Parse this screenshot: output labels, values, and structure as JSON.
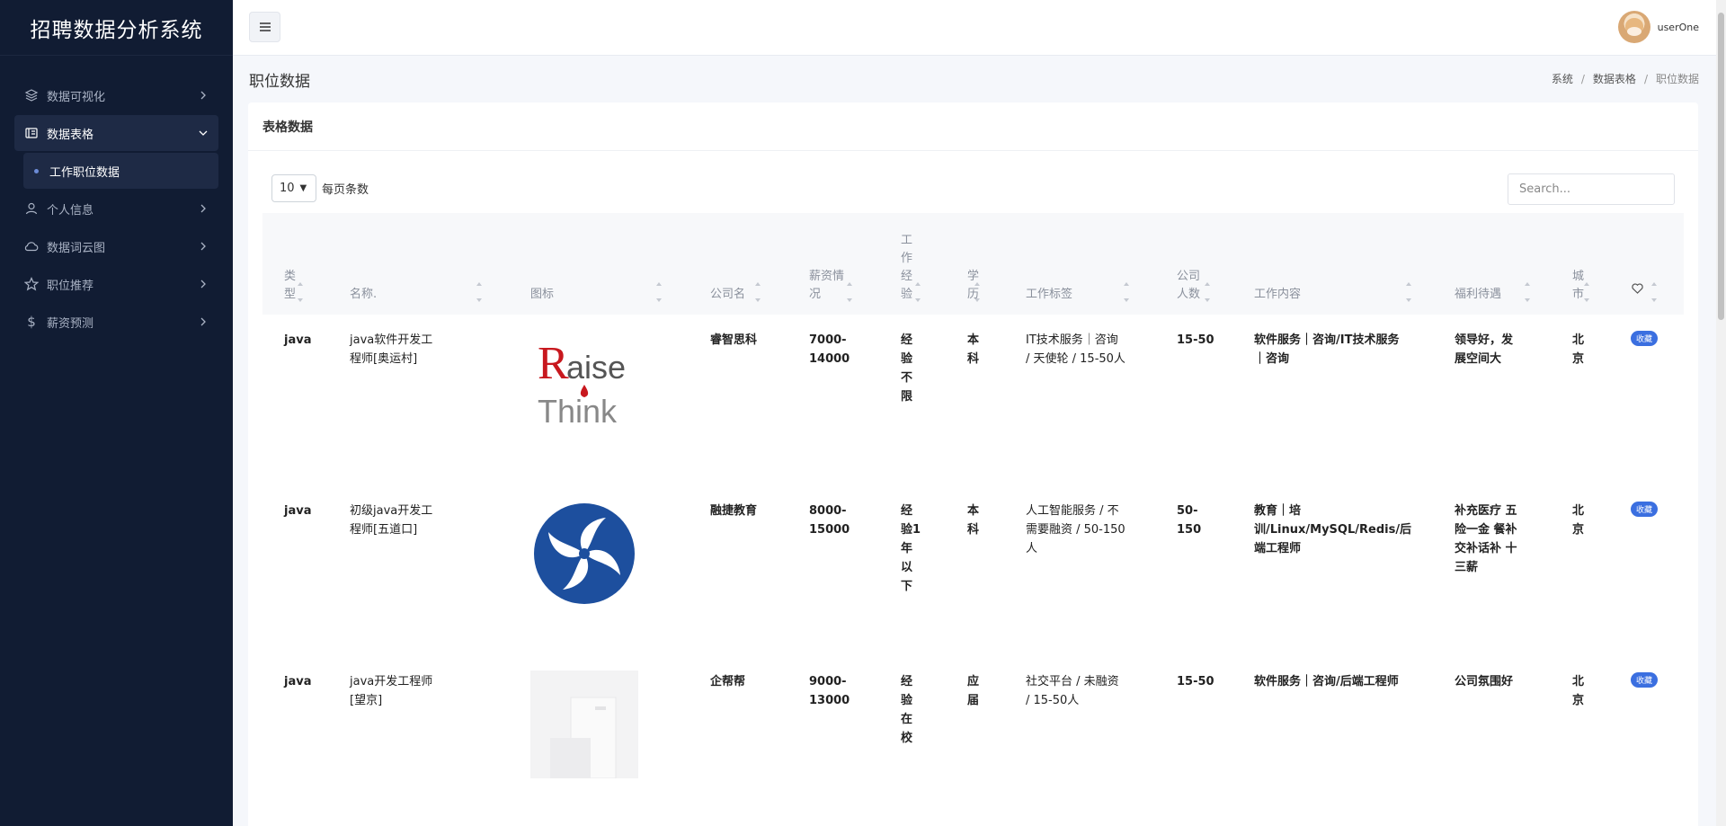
{
  "app": {
    "title": "招聘数据分析系统"
  },
  "sidebar": {
    "items": [
      {
        "label": "数据可视化",
        "icon": "layers-icon"
      },
      {
        "label": "数据表格",
        "icon": "table-icon",
        "expanded": true
      },
      {
        "label": "个人信息",
        "icon": "user-icon"
      },
      {
        "label": "数据词云图",
        "icon": "cloud-icon"
      },
      {
        "label": "职位推荐",
        "icon": "star-icon"
      },
      {
        "label": "薪资预测",
        "icon": "dollar-icon"
      }
    ],
    "subitems": [
      {
        "label": "工作职位数据"
      }
    ]
  },
  "header": {
    "username": "userOne"
  },
  "page": {
    "title": "职位数据",
    "breadcrumb": [
      "系统",
      "数据表格",
      "职位数据"
    ]
  },
  "card": {
    "title": "表格数据",
    "per_page_value": "10",
    "per_page_label": "每页条数",
    "search_placeholder": "Search..."
  },
  "table": {
    "headers": {
      "type": "类\n型",
      "name": "名称.",
      "logo": "图标",
      "company": "公司名",
      "salary": "薪资情\n况",
      "experience": "工\n作\n经\n验",
      "education": "学\n历",
      "tags": "工作标签",
      "size": "公司\n人数",
      "content": "工作内容",
      "benefits": "福利待遇",
      "city": "城\n市"
    },
    "rows": [
      {
        "type": "java",
        "name": "java软件开发工\n程师[奥运村]",
        "logo": "raise-think-logo",
        "company": "睿智思科",
        "salary": "7000-\n14000",
        "experience": "经\n验\n不\n限",
        "education": "本\n科",
        "tags": "IT技术服务｜咨询\n/ 天使轮 / 15-50人",
        "size": "15-50",
        "content": "软件服务｜咨询/IT技术服务\n｜咨询",
        "benefits": "领导好，发\n展空间大",
        "city": "北\n京",
        "fav": "收藏"
      },
      {
        "type": "java",
        "name": "初级java开发工\n程师[五道口]",
        "logo": "blue-circle-logo",
        "company": "融捷教育",
        "salary": "8000-\n15000",
        "experience": "经\n验1\n年\n以\n下",
        "education": "本\n科",
        "tags": "人工智能服务 / 不\n需要融资 / 50-150\n人",
        "size": "50-\n150",
        "content": "教育｜培\n训/Linux/MySQL/Redis/后\n端工程师",
        "benefits": "补充医疗 五\n险一金 餐补\n交补话补 十\n三薪",
        "city": "北\n京",
        "fav": "收藏"
      },
      {
        "type": "java",
        "name": "java开发工程师\n[望京]",
        "logo": "building-placeholder-logo",
        "company": "企帮帮",
        "salary": "9000-\n13000",
        "experience": "经\n验\n在\n校",
        "education": "应\n届",
        "tags": "社交平台 / 未融资\n/ 15-50人",
        "size": "15-50",
        "content": "软件服务｜咨询/后端工程师",
        "benefits": "公司氛围好",
        "city": "北\n京",
        "fav": "收藏"
      }
    ],
    "logo_text": {
      "raise": "R",
      "raise_rest": "aise",
      "think": "Think"
    }
  },
  "colors": {
    "sidebar_bg": "#111c33",
    "accent": "#3b6fe0",
    "raise_red": "#c8181e"
  }
}
